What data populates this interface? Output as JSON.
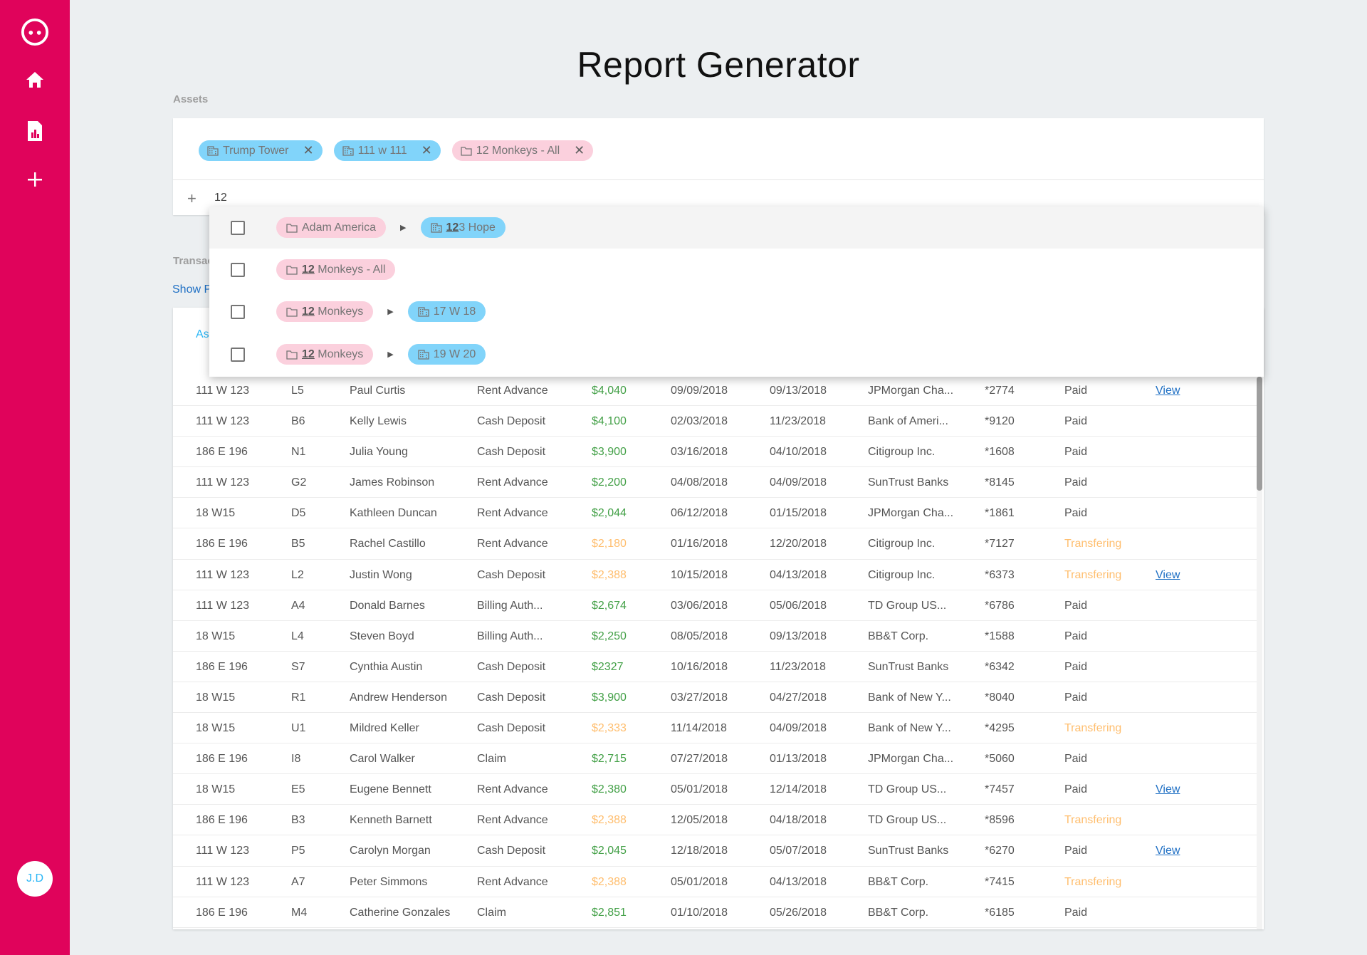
{
  "sidebar": {
    "avatar_initials": "J.D",
    "items": [
      "logo-icon",
      "home-icon",
      "report-icon",
      "plus-icon"
    ]
  },
  "page": {
    "title": "Report Generator"
  },
  "assets": {
    "label": "Assets",
    "chips": [
      {
        "text": "Trump Tower",
        "type": "building"
      },
      {
        "text": "111 w 111",
        "type": "building"
      },
      {
        "text": "12 Monkeys - All",
        "type": "folder"
      }
    ],
    "input_value": "12"
  },
  "transactions": {
    "label": "Transac",
    "show_link": "Show P",
    "header_partial": "As"
  },
  "dropdown": [
    {
      "parent": "Adam America",
      "child_match": "12",
      "child_rest": "3 Hope"
    },
    {
      "parent_match": "12",
      "parent_rest": " Monkeys - All"
    },
    {
      "parent_match": "12",
      "parent_rest": " Monkeys",
      "child": "17 W 18"
    },
    {
      "parent_match": "12",
      "parent_rest": " Monkeys",
      "child": "19 W 20"
    }
  ],
  "rows": [
    [
      "111 W 123",
      "L5",
      "Paul Curtis",
      "Rent Advance",
      "$4,040",
      "09/09/2018",
      "09/13/2018",
      "JPMorgan Cha...",
      "*2774",
      "Paid",
      "View"
    ],
    [
      "111 W 123",
      "B6",
      "Kelly Lewis",
      "Cash Deposit",
      "$4,100",
      "02/03/2018",
      "11/23/2018",
      "Bank of Ameri...",
      "*9120",
      "Paid",
      ""
    ],
    [
      "186 E 196",
      "N1",
      "Julia Young",
      "Cash Deposit",
      "$3,900",
      "03/16/2018",
      "04/10/2018",
      "Citigroup Inc.",
      "*1608",
      "Paid",
      ""
    ],
    [
      "111 W 123",
      "G2",
      "James Robinson",
      "Rent Advance",
      "$2,200",
      "04/08/2018",
      "04/09/2018",
      "SunTrust Banks",
      "*8145",
      "Paid",
      ""
    ],
    [
      "18 W15",
      "D5",
      "Kathleen Duncan",
      "Rent Advance",
      "$2,044",
      "06/12/2018",
      "01/15/2018",
      "JPMorgan Cha...",
      "*1861",
      "Paid",
      ""
    ],
    [
      "186 E 196",
      "B5",
      "Rachel Castillo",
      "Rent Advance",
      "$2,180",
      "01/16/2018",
      "12/20/2018",
      "Citigroup Inc.",
      "*7127",
      "Transfering",
      ""
    ],
    [
      "111 W 123",
      "L2",
      "Justin Wong",
      "Cash Deposit",
      "$2,388",
      "10/15/2018",
      "04/13/2018",
      "Citigroup Inc.",
      "*6373",
      "Transfering",
      "View"
    ],
    [
      "111 W 123",
      "A4",
      "Donald Barnes",
      "Billing Auth...",
      "$2,674",
      "03/06/2018",
      "05/06/2018",
      "TD Group US...",
      "*6786",
      "Paid",
      ""
    ],
    [
      "18 W15",
      "L4",
      "Steven Boyd",
      "Billing Auth...",
      "$2,250",
      "08/05/2018",
      "09/13/2018",
      "BB&T Corp.",
      "*1588",
      "Paid",
      ""
    ],
    [
      "186 E 196",
      "S7",
      "Cynthia Austin",
      "Cash Deposit",
      "$2327",
      "10/16/2018",
      "11/23/2018",
      "SunTrust Banks",
      "*6342",
      "Paid",
      ""
    ],
    [
      "18 W15",
      "R1",
      "Andrew Henderson",
      "Cash Deposit",
      "$3,900",
      "03/27/2018",
      "04/27/2018",
      "Bank of New Y...",
      "*8040",
      "Paid",
      ""
    ],
    [
      "18 W15",
      "U1",
      "Mildred Keller",
      "Cash Deposit",
      "$2,333",
      "11/14/2018",
      "04/09/2018",
      "Bank of New Y...",
      "*4295",
      "Transfering",
      ""
    ],
    [
      "186 E 196",
      "I8",
      "Carol Walker",
      "Claim",
      "$2,715",
      "07/27/2018",
      "01/13/2018",
      "JPMorgan Cha...",
      "*5060",
      "Paid",
      ""
    ],
    [
      "18 W15",
      "E5",
      "Eugene Bennett",
      "Rent Advance",
      "$2,380",
      "05/01/2018",
      "12/14/2018",
      "TD Group US...",
      "*7457",
      "Paid",
      "View"
    ],
    [
      "186 E 196",
      "B3",
      "Kenneth Barnett",
      "Rent Advance",
      "$2,388",
      "12/05/2018",
      "04/18/2018",
      "TD Group US...",
      "*8596",
      "Transfering",
      ""
    ],
    [
      "111 W 123",
      "P5",
      "Carolyn Morgan",
      "Cash Deposit",
      "$2,045",
      "12/18/2018",
      "05/07/2018",
      "SunTrust Banks",
      "*6270",
      "Paid",
      "View"
    ],
    [
      "111 W 123",
      "A7",
      "Peter Simmons",
      "Rent Advance",
      "$2,388",
      "05/01/2018",
      "04/13/2018",
      "BB&T Corp.",
      "*7415",
      "Transfering",
      ""
    ],
    [
      "186 E 196",
      "M4",
      "Catherine Gonzales",
      "Claim",
      "$2,851",
      "01/10/2018",
      "05/26/2018",
      "BB&T Corp.",
      "*6185",
      "Paid",
      ""
    ]
  ],
  "colors": {
    "accent": "#e0035b",
    "paid_amount": "#43a047",
    "transfer": "#ffbe6e",
    "link": "#1e6fc4",
    "chip_blue": "#81d4fa",
    "chip_pink": "#fbd0dd"
  }
}
